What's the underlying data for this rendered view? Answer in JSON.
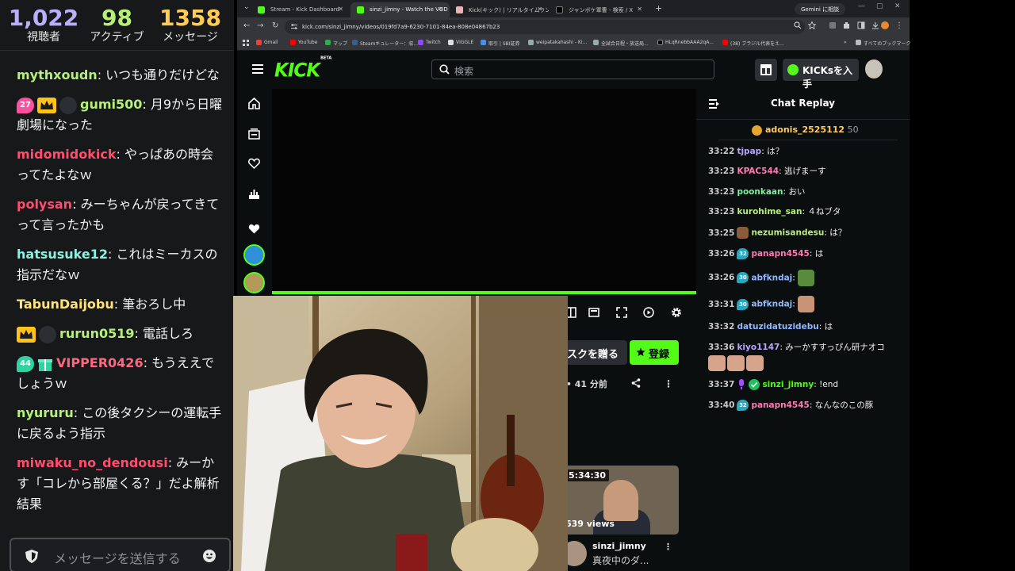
{
  "overlay": {
    "stats": [
      {
        "value": "1,022",
        "label": "視聴者"
      },
      {
        "value": "98",
        "label": "アクティブ"
      },
      {
        "value": "1358",
        "label": "メッセージ"
      }
    ],
    "messages": [
      {
        "user": "mythxoudn",
        "color": "#b7ef7b",
        "text": "いつも通りだけどな"
      },
      {
        "user": "gumi500",
        "color": "#b7ef7b",
        "text": "月9から日曜劇場になった",
        "badge": "27"
      },
      {
        "user": "midomidokick",
        "color": "#ff4d6d",
        "text": "やっぱあの時会ってたよなｗ"
      },
      {
        "user": "polysan",
        "color": "#ff4d6d",
        "text": "みーちゃんが戻ってきてって言ったかも"
      },
      {
        "user": "hatsusuke12",
        "color": "#8ef0e0",
        "text": "これはミーカスの指示だなｗ"
      },
      {
        "user": "TabunDaijobu",
        "color": "#ffe27a",
        "text": "筆おろし中"
      },
      {
        "user": "rurun0519",
        "color": "#b7ef7b",
        "text": "電話しろ"
      },
      {
        "user": "VIPPER0426",
        "color": "#ff6680",
        "text": "もうええでしょうｗ",
        "badge": "44"
      },
      {
        "user": "nyururu",
        "color": "#b7ef7b",
        "text": "この後タクシーの運転手に戻るよう指示"
      },
      {
        "user": "miwaku_no_dendousi",
        "color": "#ff4d6d",
        "text": "みーかす「コレから部屋くる？」だよ解析結果"
      }
    ],
    "input_placeholder": "メッセージを送信する"
  },
  "browser": {
    "tabs": [
      {
        "title": "Stream - Kick Dashboard"
      },
      {
        "title": "sinzi_jimny - Watch the VOD on Kick"
      },
      {
        "title": "Kick(キック) | リアルタイムランキング"
      },
      {
        "title": "ジャンボケ軍曹 - 検索 / X"
      }
    ],
    "gemini_label": "Gemini に相談",
    "url": "kick.com/sinzi_jimny/videos/019fd7a9-6230-7101-84ea-808e04867b23",
    "bookmarks": [
      "Gmail",
      "YouTube",
      "マップ",
      "Steamキュレーター：収...",
      "Twitch",
      "VIGGLE",
      "取引 | SBI証券",
      "weipatakahashi - Ki...",
      "全試合日程・放送局...",
      "HLqRnebbAAA2qA...",
      "(38) ブラジル代表をえ...",
      "すべてのブックマーク"
    ]
  },
  "kick": {
    "logo": "KICK",
    "logo_beta": "BETA",
    "search_placeholder": "検索",
    "kicks_button": "KICKsを入手",
    "follow_button": "スクを贈る",
    "subscribe_button": "登録",
    "meta": "数 • 41 分前",
    "card": {
      "duration": "5:34:30",
      "views": "639 views",
      "channel": "sinzi_jimny",
      "title": "真夜中のダ..."
    }
  },
  "replay": {
    "title": "Chat Replay",
    "pinned_user": "adonis_2525112",
    "pinned_amount": "50",
    "messages": [
      {
        "time": "33:22",
        "user": "tjpap",
        "color": "#b7a6ff",
        "text": "は？"
      },
      {
        "time": "33:23",
        "user": "KPAC544",
        "color": "#ff7ab0",
        "text": "逃げまーす"
      },
      {
        "time": "33:23",
        "user": "poonkaan",
        "color": "#7ef29d",
        "text": "おい"
      },
      {
        "time": "33:23",
        "user": "kurohime_san",
        "color": "#b7ef7b",
        "text": "４ねブタ"
      },
      {
        "time": "33:25",
        "user": "nezumisandesu",
        "color": "#b7ef7b",
        "text": "は？",
        "badge": "ava"
      },
      {
        "time": "33:26",
        "user": "panapn4545",
        "color": "#ff7ab0",
        "text": "は",
        "badge": "32"
      },
      {
        "time": "33:26",
        "user": "abfkndaj",
        "color": "#8eb8ff",
        "text": "",
        "badge": "30",
        "emote": true
      },
      {
        "time": "33:31",
        "user": "abfkndaj",
        "color": "#8eb8ff",
        "text": "",
        "badge": "30",
        "emote": true
      },
      {
        "time": "33:32",
        "user": "datuzidatuzidebu",
        "color": "#8eb8ff",
        "text": "は"
      },
      {
        "time": "33:36",
        "user": "kiyo1147",
        "color": "#b7a6ff",
        "text": "みーかすすっぴん研ナオコ",
        "emote_row": 3
      },
      {
        "time": "33:37",
        "user": "sinzi_jimny",
        "color": "#53fc18",
        "text": "!end",
        "badge": "mod"
      },
      {
        "time": "33:40",
        "user": "panapn4545",
        "color": "#ff7ab0",
        "text": "なんなのこの豚",
        "badge": "32"
      }
    ]
  }
}
